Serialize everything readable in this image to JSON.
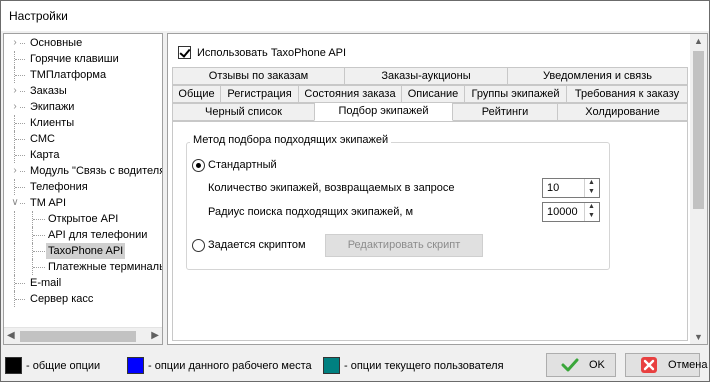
{
  "window": {
    "title": "Настройки"
  },
  "tree": {
    "items": [
      {
        "label": "Основные",
        "expandable": true
      },
      {
        "label": "Горячие клавиши",
        "expandable": false
      },
      {
        "label": "ТМПлатформа",
        "expandable": false
      },
      {
        "label": "Заказы",
        "expandable": true
      },
      {
        "label": "Экипажи",
        "expandable": true
      },
      {
        "label": "Клиенты",
        "expandable": false
      },
      {
        "label": "СМС",
        "expandable": false
      },
      {
        "label": "Карта",
        "expandable": false
      },
      {
        "label": "Модуль \"Связь с водителя",
        "expandable": true
      },
      {
        "label": "Телефония",
        "expandable": false
      },
      {
        "label": "TM API",
        "expandable": true,
        "expanded": true
      },
      {
        "label": "Открытое API",
        "child": true
      },
      {
        "label": "API для телефонии",
        "child": true
      },
      {
        "label": "TaxoPhone API",
        "child": true,
        "selected": true
      },
      {
        "label": "Платежные терминалы",
        "child": true
      },
      {
        "label": "E-mail",
        "expandable": false
      },
      {
        "label": "Сервер касс",
        "expandable": false
      }
    ]
  },
  "panel": {
    "use_api_checkbox": {
      "label": "Использовать TaxoPhone API",
      "checked": true
    },
    "tabs_row1": [
      "Отзывы по заказам",
      "Заказы-аукционы",
      "Уведомления и связь"
    ],
    "tabs_row2": [
      "Общие",
      "Регистрация",
      "Состояния заказа",
      "Описание",
      "Группы экипажей",
      "Требования к заказу"
    ],
    "tabs_row3": [
      "Черный список",
      "Подбор экипажей",
      "Рейтинги",
      "Холдирование"
    ],
    "active_tab": "Подбор экипажей",
    "group": {
      "title": "Метод подбора подходящих экипажей",
      "radio_standard": "Стандартный",
      "count_label": "Количество экипажей, возвращаемых в запросе",
      "count_value": "10",
      "radius_label": "Радиус поиска подходящих экипажей, м",
      "radius_value": "10000",
      "radio_script": "Задается скриптом",
      "edit_script_button": "Редактировать скрипт"
    }
  },
  "legend": [
    {
      "label": "- общие опции",
      "color": "#000000"
    },
    {
      "label": "- опции данного рабочего места",
      "color": "#0000ff"
    },
    {
      "label": "- опции текущего пользователя",
      "color": "#008080"
    }
  ],
  "buttons": {
    "ok": "OK",
    "cancel": "Отмена"
  }
}
